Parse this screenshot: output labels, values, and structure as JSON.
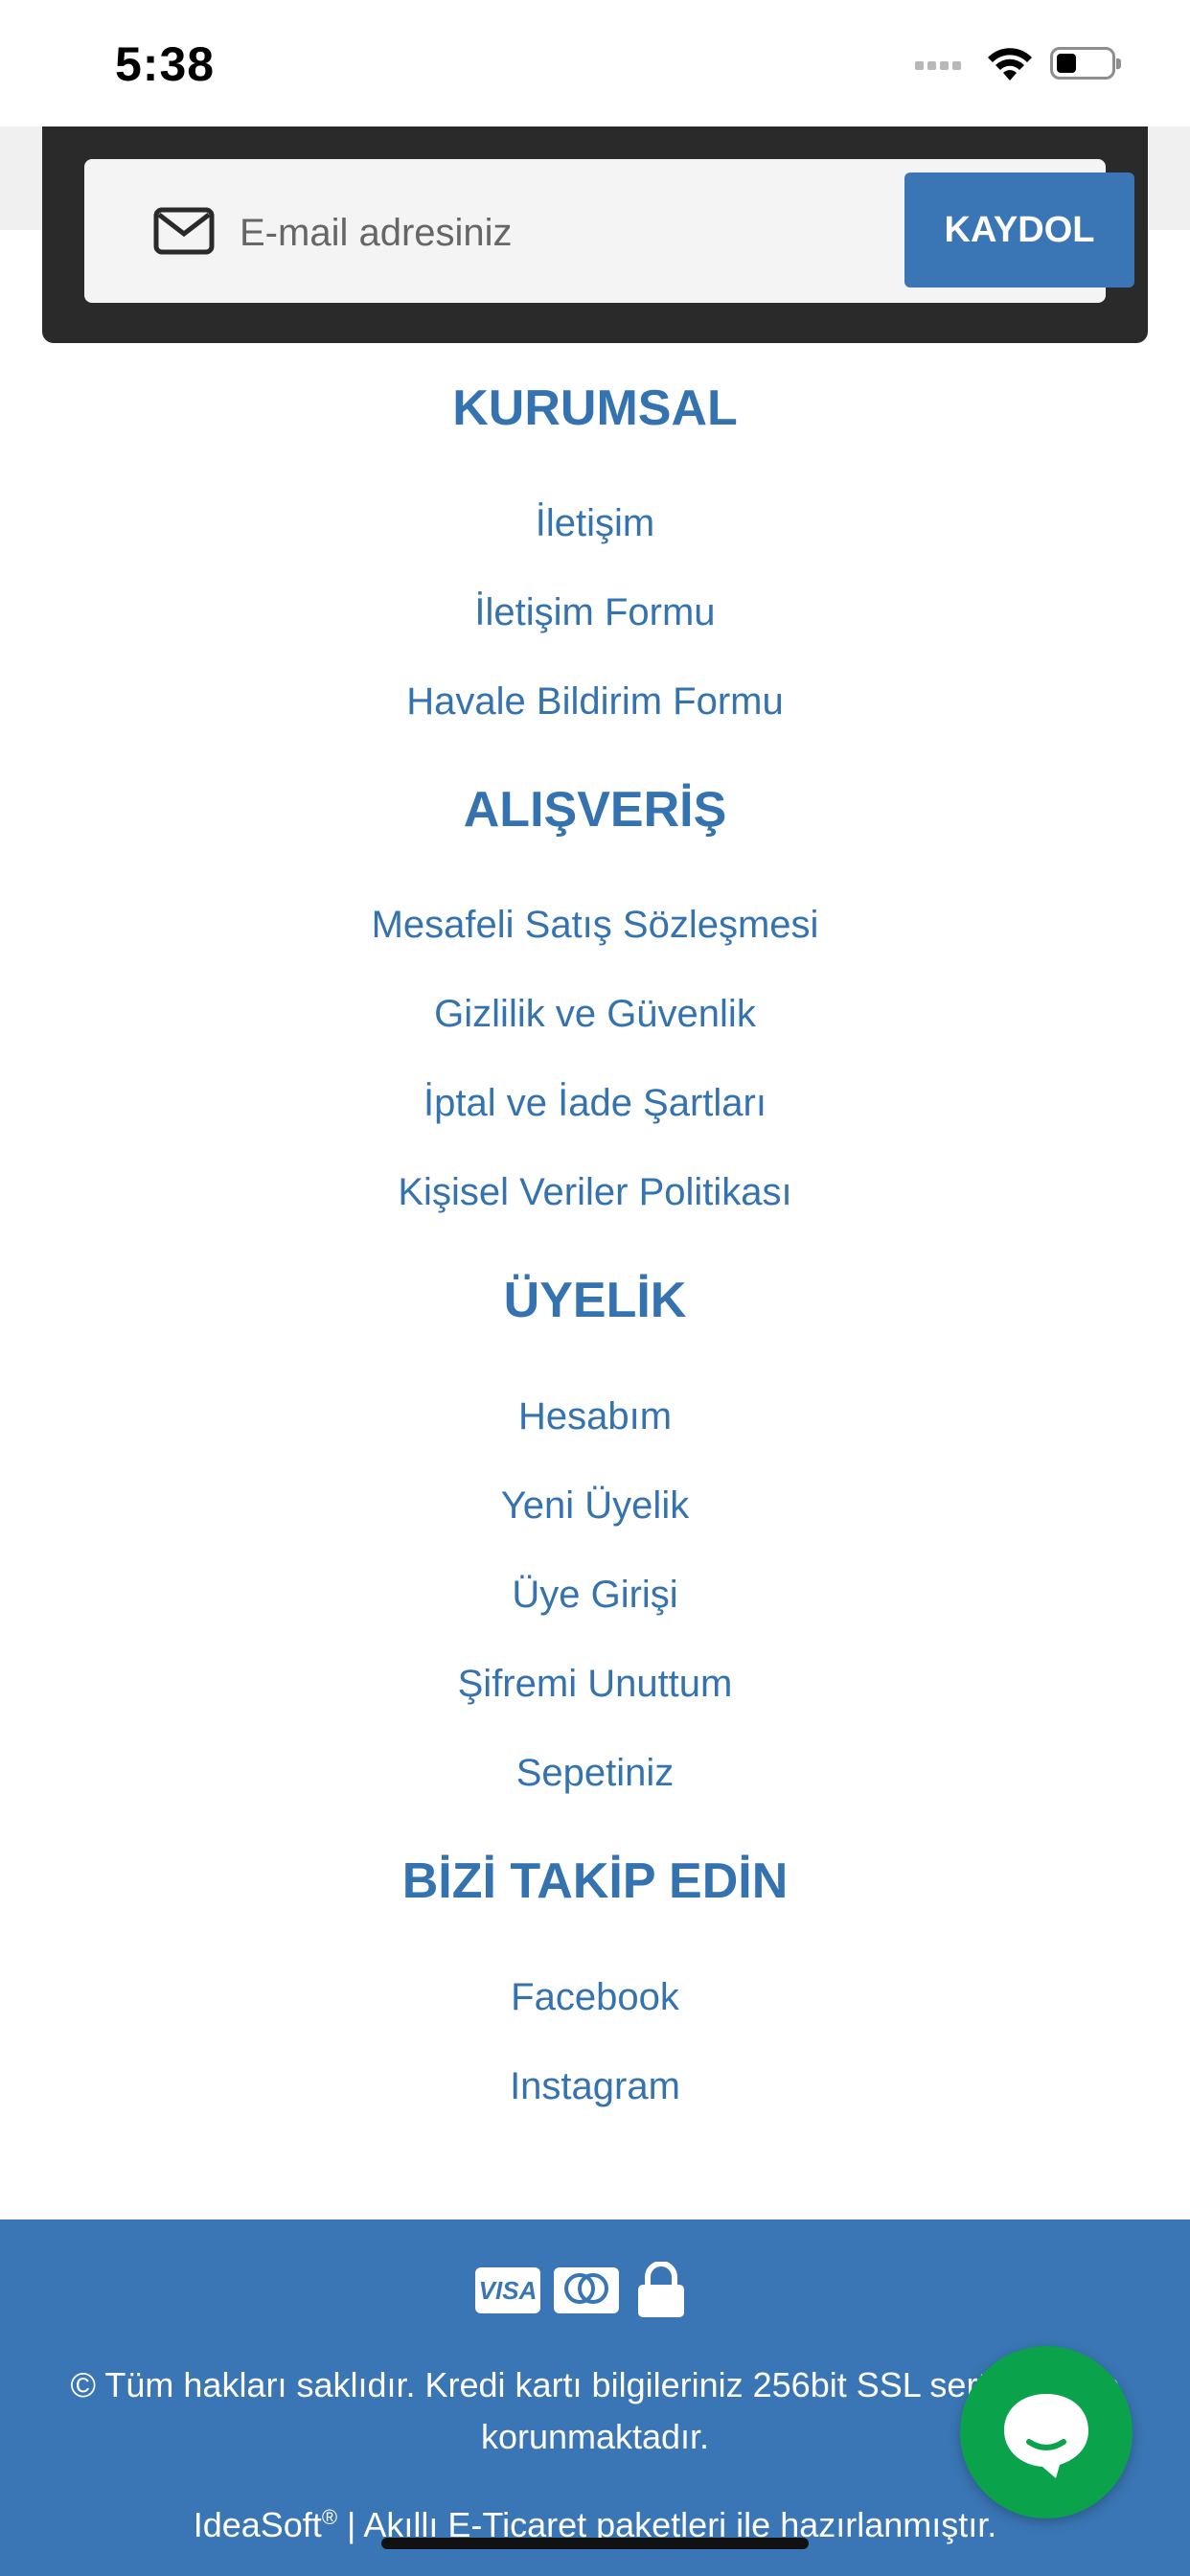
{
  "status_bar": {
    "time": "5:38"
  },
  "newsletter": {
    "placeholder": "E-mail adresiniz",
    "button_label": "KAYDOL"
  },
  "sections": [
    {
      "title": "KURUMSAL",
      "links": [
        "İletişim",
        "İletişim Formu",
        "Havale Bildirim Formu"
      ]
    },
    {
      "title": "ALIŞVERİŞ",
      "links": [
        "Mesafeli Satış Sözleşmesi",
        "Gizlilik ve Güvenlik",
        "İptal ve İade Şartları",
        "Kişisel Veriler Politikası"
      ]
    },
    {
      "title": "ÜYELİK",
      "links": [
        "Hesabım",
        "Yeni Üyelik",
        "Üye Girişi",
        "Şifremi Unuttum",
        "Sepetiniz"
      ]
    },
    {
      "title": "BİZİ TAKİP EDİN",
      "links": [
        "Facebook",
        "Instagram"
      ]
    }
  ],
  "footer": {
    "visa_label": "VISA",
    "copyright": "© Tüm hakları saklıdır. Kredi kartı bilgileriniz 256bit SSL sertifikası ile korunmaktadır.",
    "brand": "IdeaSoft",
    "brand_mark": "®",
    "credit_rest": " | Akıllı E-Ticaret paketleri ile hazırlanmıştır."
  },
  "colors": {
    "accent": "#3a76b5",
    "link": "#3572b0",
    "chat": "#0aa24a"
  }
}
